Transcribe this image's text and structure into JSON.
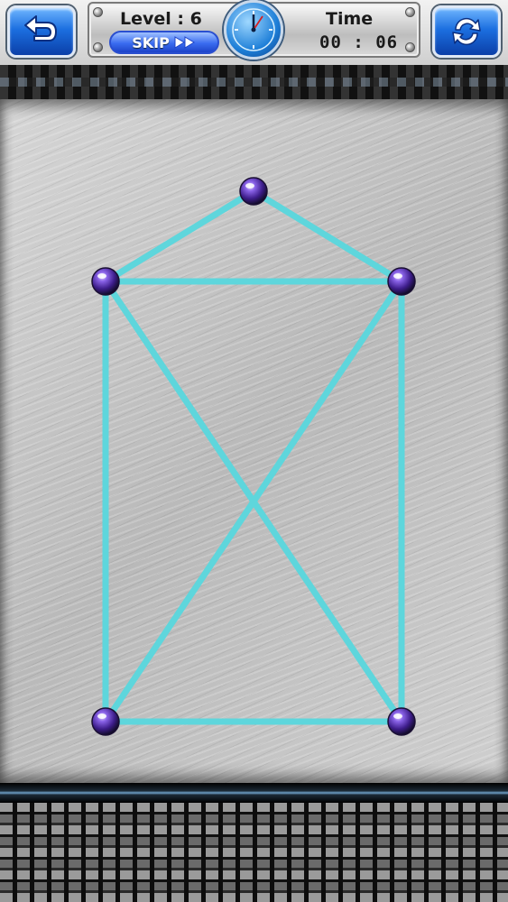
{
  "header": {
    "level_text": "Level : 6",
    "skip_label": "SKIP",
    "time_label": "Time",
    "time_value": "00 : 06"
  },
  "buttons": {
    "back_icon": "back-arrow-icon",
    "reload_icon": "reload-icon",
    "clock_icon": "clock-icon"
  },
  "colors": {
    "line": "#5ed6dc",
    "node": "#6a3fc8",
    "button_blue": "#1c6fe0"
  },
  "puzzle": {
    "nodes": [
      {
        "id": "top"
      },
      {
        "id": "upper-left"
      },
      {
        "id": "upper-right"
      },
      {
        "id": "lower-left"
      },
      {
        "id": "lower-right"
      }
    ],
    "edges": [
      [
        "top",
        "upper-left"
      ],
      [
        "top",
        "upper-right"
      ],
      [
        "upper-left",
        "upper-right"
      ],
      [
        "upper-left",
        "lower-left"
      ],
      [
        "upper-right",
        "lower-right"
      ],
      [
        "lower-left",
        "lower-right"
      ],
      [
        "upper-left",
        "lower-right"
      ],
      [
        "upper-right",
        "lower-left"
      ]
    ]
  }
}
